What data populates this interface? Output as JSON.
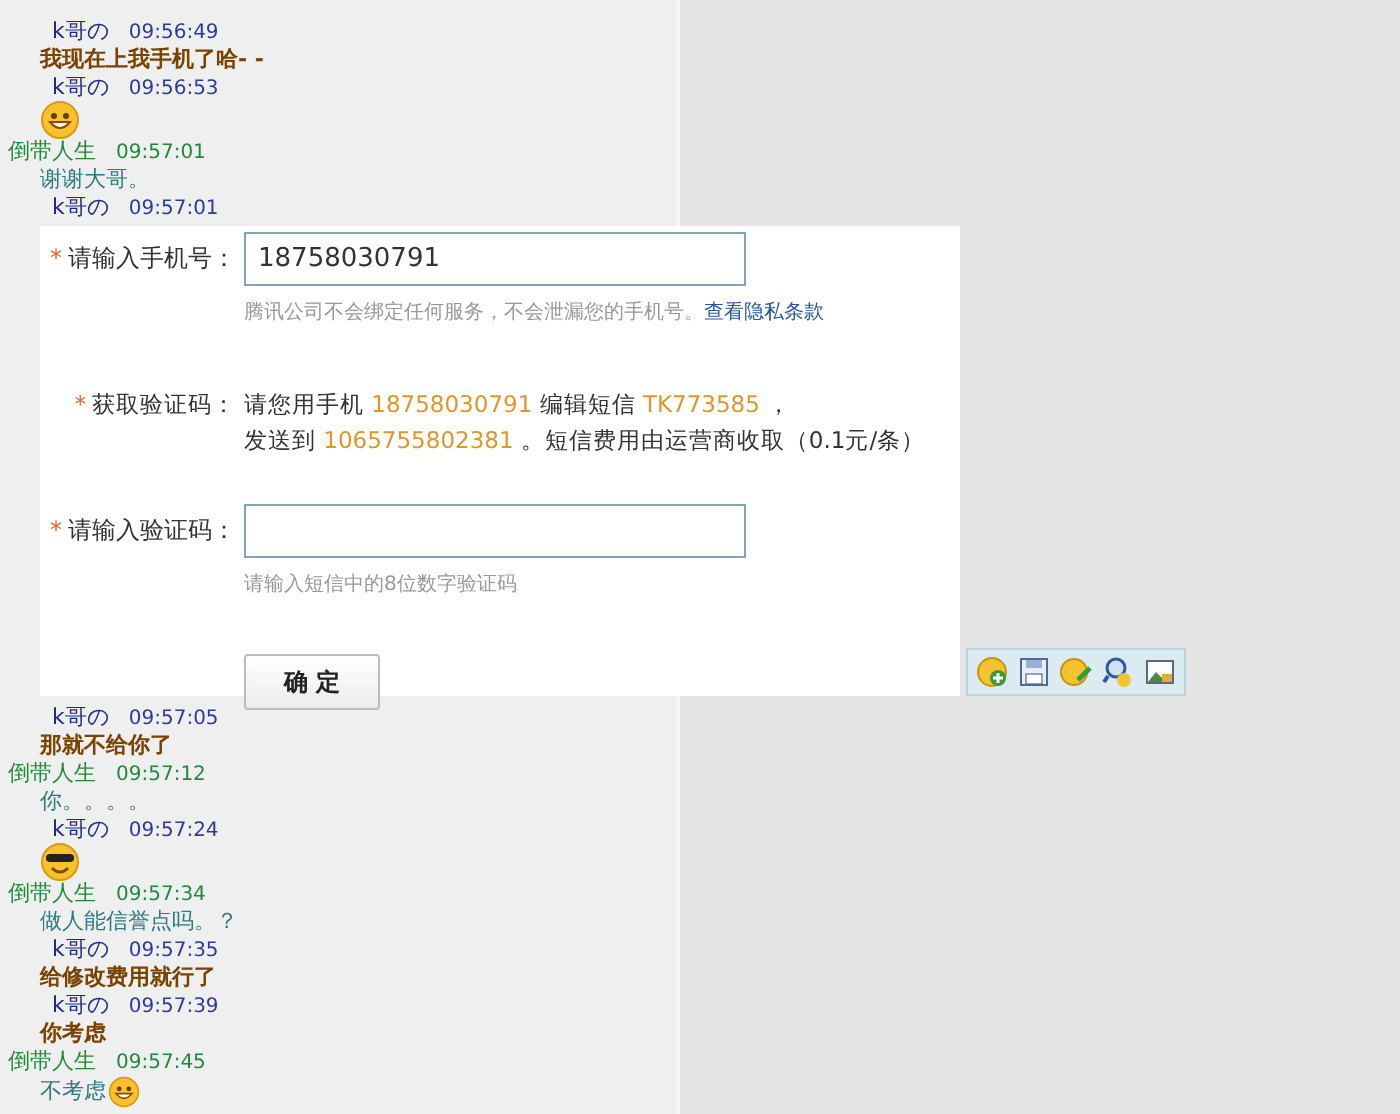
{
  "chat_top": [
    {
      "kind": "header",
      "from_me": false,
      "sender": "k哥の",
      "time": "09:56:49"
    },
    {
      "kind": "text",
      "from_me": false,
      "text": "我现在上我手机了哈- -"
    },
    {
      "kind": "header",
      "from_me": false,
      "sender": "k哥の",
      "time": "09:56:53"
    },
    {
      "kind": "emoji_grin"
    },
    {
      "kind": "header",
      "from_me": true,
      "sender": "倒带人生",
      "time": "09:57:01"
    },
    {
      "kind": "text",
      "from_me": true,
      "text": "谢谢大哥。"
    },
    {
      "kind": "header",
      "from_me": false,
      "sender": "k哥の",
      "time": "09:57:01"
    }
  ],
  "form": {
    "rows": [
      {
        "kind": "input",
        "marker": "*",
        "label": "请输入手机号：",
        "value": "18758030791",
        "hint": "腾讯公司不会绑定任何服务，不会泄漏您的手机号。",
        "link": "查看隐私条款"
      },
      {
        "kind": "info",
        "marker": "*",
        "label": "获取验证码：",
        "lines": [
          [
            {
              "text": "请您用手机 ",
              "highlight": false
            },
            {
              "text": "18758030791",
              "highlight": true
            },
            {
              "text": " 编辑短信 ",
              "highlight": false
            },
            {
              "text": "TK773585",
              "highlight": true
            },
            {
              "text": " ，",
              "highlight": false
            }
          ],
          [
            {
              "text": "发送到 ",
              "highlight": false
            },
            {
              "text": "1065755802381",
              "highlight": true
            },
            {
              "text": " 。短信费用由运营商收取（0.1元/条）",
              "highlight": false
            }
          ]
        ]
      },
      {
        "kind": "input",
        "marker": "*",
        "label": "请输入验证码：",
        "value": "",
        "hint": "请输入短信中的8位数字验证码"
      }
    ],
    "button": "确 定"
  },
  "chat_bottom": [
    {
      "kind": "header",
      "from_me": false,
      "sender": "k哥の",
      "time": "09:57:05"
    },
    {
      "kind": "text",
      "from_me": false,
      "text": "那就不给你了"
    },
    {
      "kind": "header",
      "from_me": true,
      "sender": "倒带人生",
      "time": "09:57:12"
    },
    {
      "kind": "text",
      "from_me": true,
      "text": "你。。。。"
    },
    {
      "kind": "header",
      "from_me": false,
      "sender": "k哥の",
      "time": "09:57:24"
    },
    {
      "kind": "emoji_cool"
    },
    {
      "kind": "header",
      "from_me": true,
      "sender": "倒带人生",
      "time": "09:57:34"
    },
    {
      "kind": "text",
      "from_me": true,
      "text": "做人能信誉点吗。？"
    },
    {
      "kind": "header",
      "from_me": false,
      "sender": "k哥の",
      "time": "09:57:35"
    },
    {
      "kind": "text",
      "from_me": false,
      "text": "给修改费用就行了"
    },
    {
      "kind": "header",
      "from_me": false,
      "sender": "k哥の",
      "time": "09:57:39"
    },
    {
      "kind": "text",
      "from_me": false,
      "text": "你考虑"
    },
    {
      "kind": "header",
      "from_me": true,
      "sender": "倒带人生",
      "time": "09:57:45"
    },
    {
      "kind": "text_emoji",
      "from_me": true,
      "text": "不考虑"
    }
  ]
}
